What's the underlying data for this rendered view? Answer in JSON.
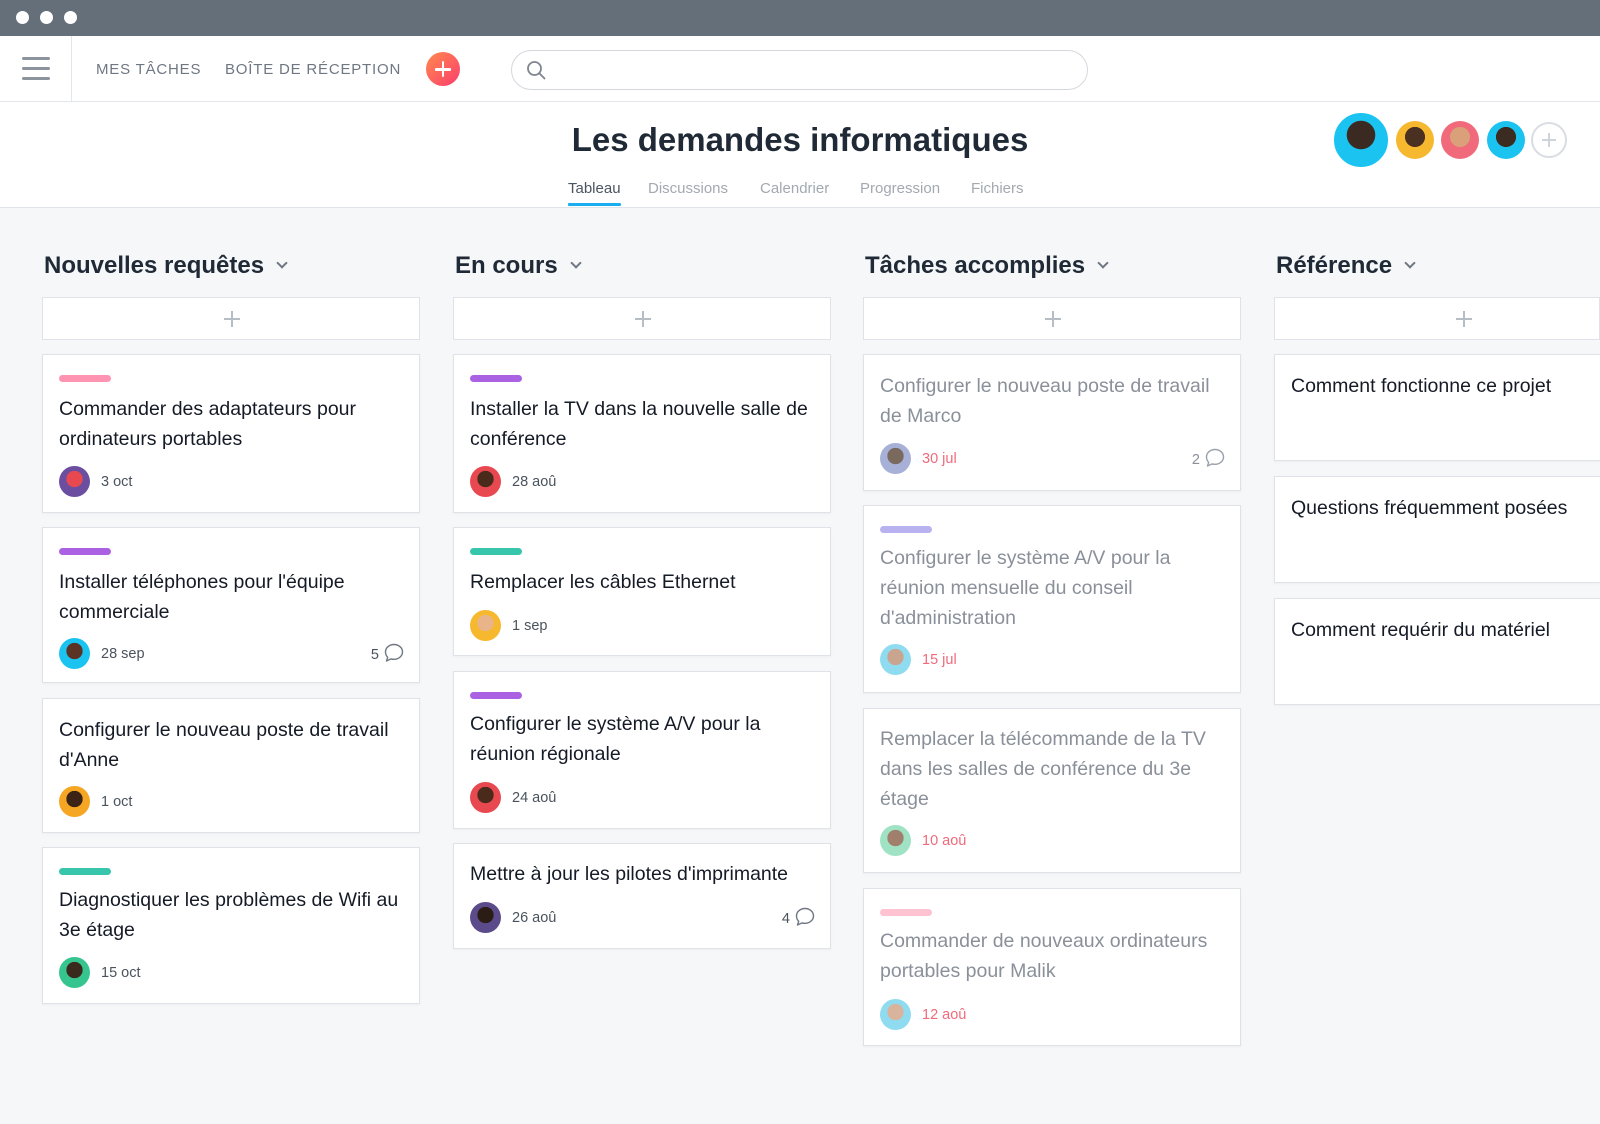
{
  "nav": {
    "my_tasks": "MES TÂCHES",
    "inbox": "BOÎTE DE RÉCEPTION",
    "search_placeholder": ""
  },
  "project": {
    "title": "Les demandes informatiques",
    "tabs": [
      {
        "label": "Tableau",
        "active": true
      },
      {
        "label": "Discussions",
        "active": false
      },
      {
        "label": "Calendrier",
        "active": false
      },
      {
        "label": "Progression",
        "active": false
      },
      {
        "label": "Fichiers",
        "active": false
      }
    ]
  },
  "colors": {
    "accent_blue": "#1aaef0",
    "add_button": "#fc3d6e",
    "tag_pink": "#ff94b2",
    "tag_purple": "#aa62e3",
    "tag_teal": "#37c5ab",
    "tag_lavender": "#b8b3f0",
    "tag_light_pink": "#ffc2d1",
    "done_date": "#f06a7c"
  },
  "columns": [
    {
      "title": "Nouvelles requêtes",
      "cards": [
        {
          "tag": "#ff94b2",
          "title": "Commander des adaptateurs pour ordinateurs portables",
          "due": "3 oct",
          "avatar": "#6b4ea0"
        },
        {
          "tag": "#aa62e3",
          "title": "Installer téléphones pour l'équipe commerciale",
          "due": "28 sep",
          "comments": "5",
          "avatar": "#1ac3f0"
        },
        {
          "tag": null,
          "title": "Configurer le nouveau poste de travail d'Anne",
          "due": "1 oct",
          "avatar": "#f5a623"
        },
        {
          "tag": "#37c5ab",
          "title": "Diagnostiquer les problèmes de Wifi au 3e étage",
          "due": "15 oct",
          "avatar": "#37c58f"
        }
      ]
    },
    {
      "title": "En cours",
      "cards": [
        {
          "tag": "#aa62e3",
          "title": "Installer la TV dans la nouvelle salle de conférence",
          "due": "28 aoû",
          "avatar": "#e8484f"
        },
        {
          "tag": "#37c5ab",
          "title": "Remplacer les câbles Ethernet",
          "due": "1 sep",
          "avatar": "#f5b82e"
        },
        {
          "tag": "#aa62e3",
          "title": "Configurer le système A/V pour la réunion régionale",
          "due": "24 aoû",
          "avatar": "#e8484f"
        },
        {
          "tag": null,
          "title": "Mettre à jour les pilotes d'imprimante",
          "due": "26 aoû",
          "comments": "4",
          "avatar": "#5b4b8a"
        }
      ]
    },
    {
      "title": "Tâches accomplies",
      "cards": [
        {
          "tag": null,
          "title": "Configurer le nouveau poste de travail de Marco",
          "due": "30 jul",
          "comments": "2",
          "avatar": "#a7b0d6",
          "done": true
        },
        {
          "tag": "#b8b3f0",
          "title": "Configurer le système A/V pour la réunion mensuelle du conseil d'administration",
          "due": "15 jul",
          "avatar": "#8fdcf0",
          "done": true
        },
        {
          "tag": null,
          "title": "Remplacer la télécommande de la TV dans les salles de conférence du 3e étage",
          "due": "10 aoû",
          "avatar": "#9fe3c4",
          "done": true
        },
        {
          "tag": "#ffc2d1",
          "title": "Commander de nouveaux ordinateurs portables pour Malik",
          "due": "12 aoû",
          "avatar": "#8fdcf0",
          "done": true
        }
      ]
    },
    {
      "title": "Référence",
      "cards": [
        {
          "tag": null,
          "title": "Comment fonctionne ce projet"
        },
        {
          "tag": null,
          "title": "Questions fréquemment posées"
        },
        {
          "tag": null,
          "title": "Comment requérir du matériel"
        }
      ]
    }
  ]
}
